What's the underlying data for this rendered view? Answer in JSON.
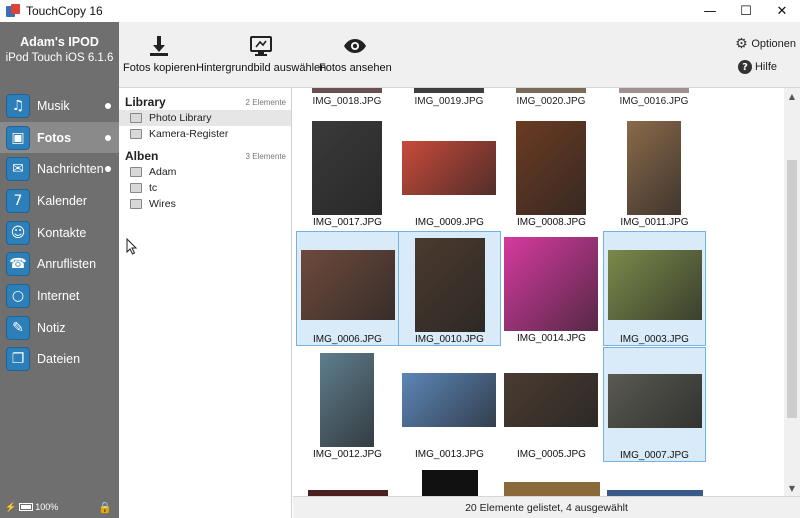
{
  "window": {
    "title": "TouchCopy 16",
    "minimize_glyph": "—",
    "maximize_glyph": "☐",
    "close_glyph": "✕"
  },
  "device": {
    "name": "Adam's IPOD",
    "model": "iPod Touch iOS 6.1.6",
    "battery": "100%"
  },
  "nav": [
    {
      "label": "Musik",
      "icon": "music-icon",
      "glyph": "♫",
      "dot": true
    },
    {
      "label": "Fotos",
      "icon": "photos-icon",
      "glyph": "▣",
      "dot": true,
      "active": true
    },
    {
      "label": "Nachrichten",
      "icon": "messages-icon",
      "glyph": "✉",
      "dot": true
    },
    {
      "label": "Kalender",
      "icon": "calendar-icon",
      "glyph": "7"
    },
    {
      "label": "Kontakte",
      "icon": "contacts-icon",
      "glyph": "☺"
    },
    {
      "label": "Anruflisten",
      "icon": "phone-icon",
      "glyph": "☎"
    },
    {
      "label": "Internet",
      "icon": "internet-icon",
      "glyph": "○"
    },
    {
      "label": "Notiz",
      "icon": "notes-icon",
      "glyph": "✎"
    },
    {
      "label": "Dateien",
      "icon": "files-icon",
      "glyph": "❐"
    }
  ],
  "toolbar": {
    "copy_photos": "Fotos kopieren",
    "set_wallpaper": "Hintergrundbild auswählen",
    "view_photos": "Fotos ansehen",
    "options": "Optionen",
    "help": "Hilfe"
  },
  "library": {
    "heading": "Library",
    "count": "2 Elemente",
    "items": [
      {
        "label": "Photo Library",
        "selected": true
      },
      {
        "label": "Kamera-Register"
      }
    ]
  },
  "albums": {
    "heading": "Alben",
    "count": "3 Elemente",
    "items": [
      {
        "label": "Adam"
      },
      {
        "label": "tc"
      },
      {
        "label": "Wires"
      }
    ]
  },
  "photos_top_row": [
    "IMG_0018.JPG",
    "IMG_0019.JPG",
    "IMG_0020.JPG",
    "IMG_0016.JPG"
  ],
  "photos": [
    {
      "name": "IMG_0017.JPG",
      "selected": false,
      "color": "#3a3a3a"
    },
    {
      "name": "IMG_0009.JPG",
      "selected": false,
      "color": "#c84a3a"
    },
    {
      "name": "IMG_0008.JPG",
      "selected": false,
      "color": "#6b3b22"
    },
    {
      "name": "IMG_0011.JPG",
      "selected": false,
      "color": "#8a6a4a"
    },
    {
      "name": "IMG_0006.JPG",
      "selected": true,
      "color": "#6d4a3c"
    },
    {
      "name": "IMG_0010.JPG",
      "selected": true,
      "color": "#4b3a2e"
    },
    {
      "name": "IMG_0014.JPG",
      "selected": false,
      "color": "#d63aa0"
    },
    {
      "name": "IMG_0003.JPG",
      "selected": true,
      "color": "#7a8a4a"
    },
    {
      "name": "IMG_0012.JPG",
      "selected": false,
      "color": "#5f7e8e"
    },
    {
      "name": "IMG_0013.JPG",
      "selected": false,
      "color": "#5c86b8"
    },
    {
      "name": "IMG_0005.JPG",
      "selected": false,
      "color": "#4a3b30"
    },
    {
      "name": "IMG_0007.JPG",
      "selected": true,
      "color": "#5a5a52"
    }
  ],
  "status": "20 Elemente gelistet, 4 ausgewählt"
}
